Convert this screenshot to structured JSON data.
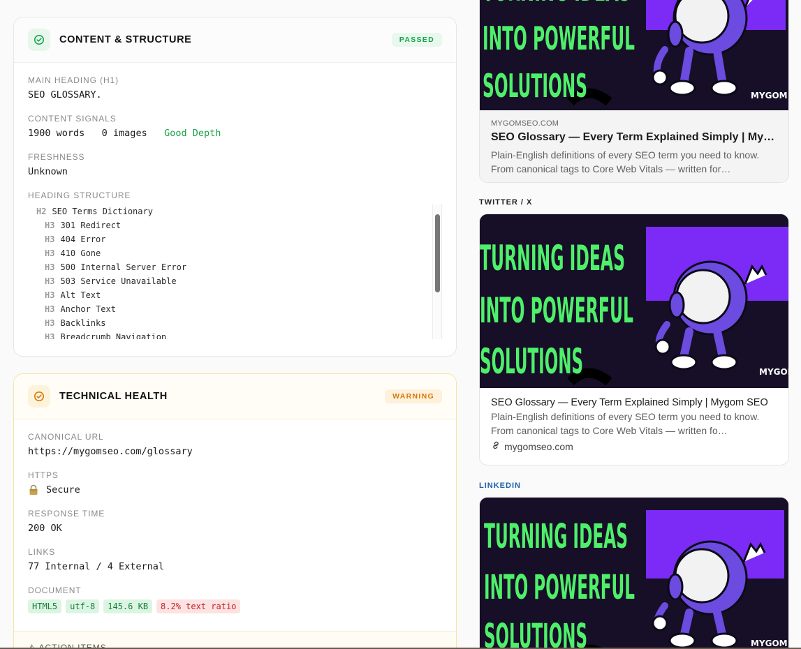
{
  "content_card": {
    "title": "CONTENT & STRUCTURE",
    "status": "PASSED",
    "main_heading_label": "MAIN HEADING (H1)",
    "main_heading_value": "SEO GLOSSARY.",
    "content_signals_label": "CONTENT SIGNALS",
    "words": "1900 words",
    "images": "0 images",
    "depth": "Good Depth",
    "freshness_label": "FRESHNESS",
    "freshness_value": "Unknown",
    "heading_structure_label": "HEADING STRUCTURE",
    "headings": [
      {
        "tag": "H2",
        "text": "SEO Terms Dictionary"
      },
      {
        "tag": "H3",
        "text": "301 Redirect"
      },
      {
        "tag": "H3",
        "text": "404 Error"
      },
      {
        "tag": "H3",
        "text": "410 Gone"
      },
      {
        "tag": "H3",
        "text": "500 Internal Server Error"
      },
      {
        "tag": "H3",
        "text": "503 Service Unavailable"
      },
      {
        "tag": "H3",
        "text": "Alt Text"
      },
      {
        "tag": "H3",
        "text": "Anchor Text"
      },
      {
        "tag": "H3",
        "text": "Backlinks"
      },
      {
        "tag": "H3",
        "text": "Breadcrumb Navigation"
      }
    ]
  },
  "technical_card": {
    "title": "TECHNICAL HEALTH",
    "status": "WARNING",
    "canonical_label": "CANONICAL URL",
    "canonical_value": "https://mygomseo.com/glossary",
    "https_label": "HTTPS",
    "https_value": "Secure",
    "response_label": "RESPONSE TIME",
    "response_value": "200 OK",
    "links_label": "LINKS",
    "links_value": "77 Internal / 4 External",
    "document_label": "DOCUMENT",
    "doc_html": "HTML5",
    "doc_charset": "utf-8",
    "doc_size": "145.6 KB",
    "doc_ratio": "8.2% text ratio",
    "action_items_label": "ACTION ITEMS"
  },
  "preview": {
    "banner_line1": "TURNING IDEAS",
    "banner_line2": "INTO POWERFUL",
    "banner_line3": "SOLUTIONS",
    "brand": "MYGOM",
    "facebook": {
      "domain": "MYGOMSEO.COM",
      "title": "SEO Glossary — Every Term Explained Simply | Mygom SEO",
      "description": "Plain-English definitions of every SEO term you need to know. From canonical tags to Core Web Vitals — written for…"
    },
    "twitter": {
      "label": "TWITTER / X",
      "title": "SEO Glossary — Every Term Explained Simply | Mygom SEO",
      "description": "Plain-English definitions of every SEO term you need to know. From canonical tags to Core Web Vitals — written fo…",
      "domain": "mygomseo.com"
    },
    "linkedin": {
      "label": "LINKEDIN"
    }
  },
  "colors": {
    "passed": "#16a34a",
    "warning": "#d97706",
    "banner_bg": "#160f27",
    "banner_text": "#4ef06a",
    "banner_purple": "#7b2bf5",
    "linkedin_label": "#1d5fa8"
  }
}
